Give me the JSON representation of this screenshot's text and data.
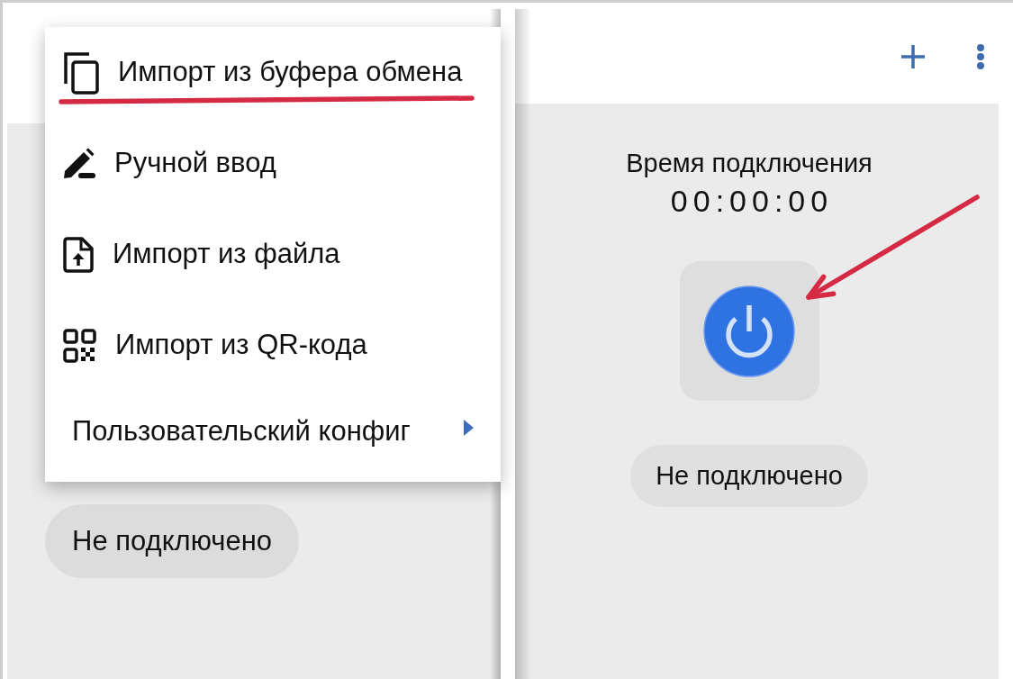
{
  "left_screen": {
    "menu": {
      "items": [
        {
          "kind": "action",
          "label": "Импорт из буфера обмена"
        },
        {
          "kind": "action",
          "label": "Ручной ввод"
        },
        {
          "kind": "action",
          "label": "Импорт из файла"
        },
        {
          "kind": "action",
          "label": "Импорт из QR-кода"
        },
        {
          "kind": "submenu",
          "label": "Пользовательский конфиг"
        }
      ]
    },
    "status": "Не подключено"
  },
  "right_screen": {
    "connection_time": {
      "label": "Время подключения",
      "value": "00:00:00"
    },
    "status": "Не подключено"
  },
  "annotations": [
    {
      "kind": "underline"
    },
    {
      "kind": "arrow"
    }
  ]
}
